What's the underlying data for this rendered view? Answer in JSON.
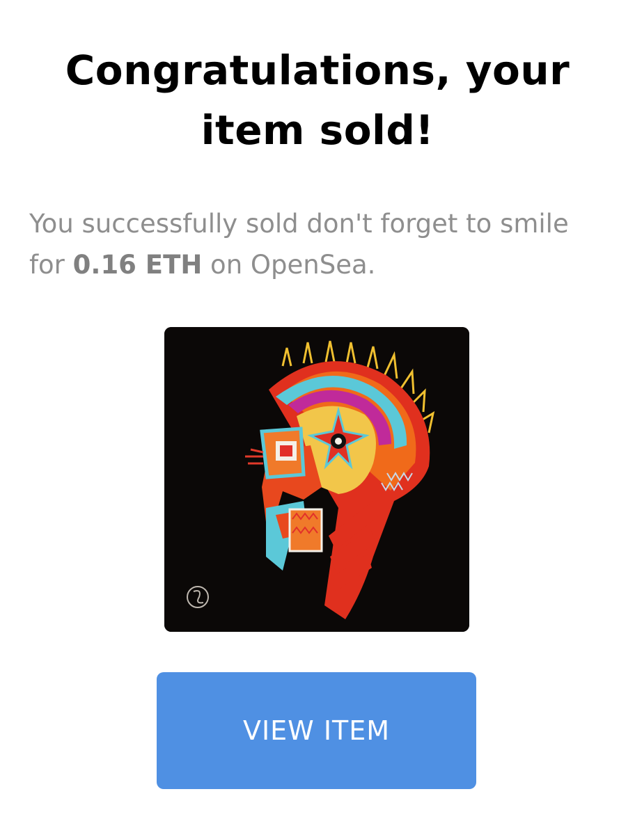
{
  "headline": {
    "line1": "Congratulations, your",
    "line2": "item sold!"
  },
  "message": {
    "prefix": "You successfully sold don't forget to smile for ",
    "price": "0.16 ETH",
    "suffix": " on OpenSea."
  },
  "artwork": {
    "icon": "abstract-head-artwork",
    "background_color": "#0b0807"
  },
  "view_button": {
    "label": "VIEW ITEM",
    "color": "#4f90e3"
  }
}
